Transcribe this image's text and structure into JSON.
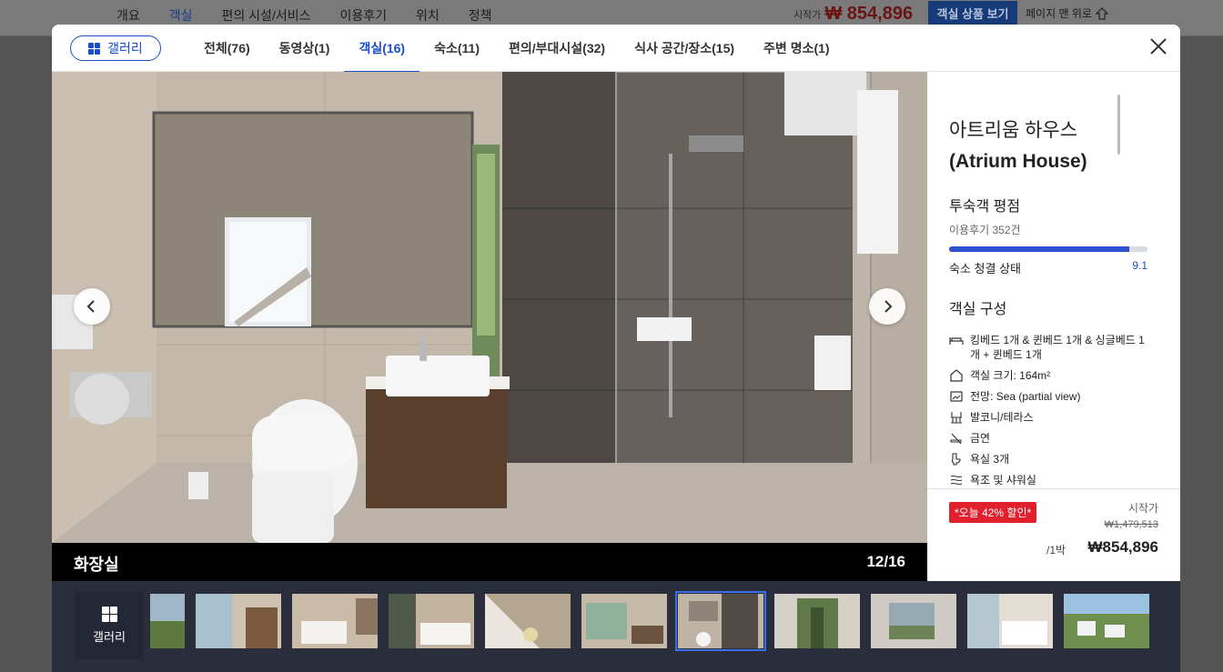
{
  "background_page": {
    "tabs": [
      "개요",
      "객실",
      "편의 시설/서비스",
      "이용후기",
      "위치",
      "정책"
    ],
    "active_tab_index": 1,
    "price_from_label": "시작가",
    "price": "₩ 854,896",
    "cta_label": "객실 상품 보기",
    "back_to_top_label": "페이지 맨 위로"
  },
  "header": {
    "gallery_button_label": "갤러리",
    "tabs": [
      {
        "label": "전체(76)"
      },
      {
        "label": "동영상(1)"
      },
      {
        "label": "객실(16)"
      },
      {
        "label": "숙소(11)"
      },
      {
        "label": "편의/부대시설(32)"
      },
      {
        "label": "식사 공간/장소(15)"
      },
      {
        "label": "주변 명소(1)"
      }
    ],
    "active_tab_index": 2
  },
  "viewer": {
    "caption": "화장실",
    "counter": "12/16"
  },
  "property": {
    "name_ko": "아트리움 하우스",
    "name_en": "(Atrium House)",
    "rating_title": "투숙객 평점",
    "reviews": "이용후기 352건",
    "cleanliness_label": "숙소 청결 상태",
    "cleanliness_score": "9.1",
    "cleanliness_fraction": 0.91,
    "room_title": "객실 구성",
    "features": [
      {
        "icon": "bed-icon",
        "text": "킹베드 1개 & 퀸베드 1개 & 싱글베드 1개 + 퀸베드 1개"
      },
      {
        "icon": "house-size-icon",
        "text": "객실 크기: 164m²"
      },
      {
        "icon": "view-icon",
        "text": "전망: Sea (partial view)"
      },
      {
        "icon": "balcony-icon",
        "text": "발코니/테라스"
      },
      {
        "icon": "no-smoking-icon",
        "text": "금연"
      },
      {
        "icon": "toilet-icon",
        "text": "욕실 3개"
      },
      {
        "icon": "shower-icon",
        "text": "욕조 및 샤워실"
      }
    ]
  },
  "pricing": {
    "deal_badge": "*오늘 42% 할인*",
    "from_label": "시작가",
    "original_price": "₩1,479,513",
    "per_night": "/1박",
    "price": "₩854,896"
  },
  "thumbnails": {
    "gallery_label": "갤러리",
    "count": 11,
    "selected_index": 6
  }
}
